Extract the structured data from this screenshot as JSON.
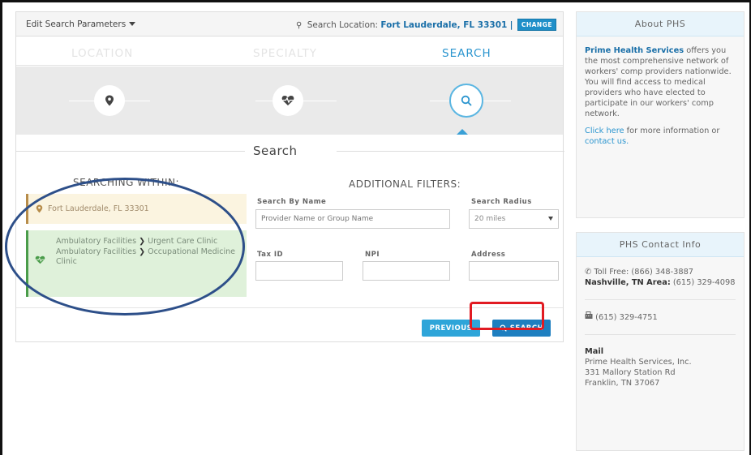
{
  "topbar": {
    "edit_label": "Edit Search Parameters",
    "location_prefix": "Search Location:",
    "location_value": "Fort Lauderdale, FL 33301",
    "separator": "|",
    "change_label": "CHANGE"
  },
  "steps": [
    {
      "label": "LOCATION"
    },
    {
      "label": "SPECIALTY"
    },
    {
      "label": "SEARCH"
    }
  ],
  "search_heading": "Search",
  "within": {
    "title": "SEARCHING WITHIN:",
    "location": "Fort Lauderdale, FL 33301",
    "spec1_a": "Ambulatory Facilities",
    "spec1_b": "Urgent Care Clinic",
    "spec2_a": "Ambulatory Facilities",
    "spec2_b": "Occupational Medicine Clinic",
    "arrow": "❯"
  },
  "filters": {
    "title": "ADDITIONAL FILTERS:",
    "name_label": "Search By Name",
    "name_placeholder": "Provider Name or Group Name",
    "radius_label": "Search Radius",
    "radius_value": "20 miles",
    "taxid_label": "Tax ID",
    "npi_label": "NPI",
    "address_label": "Address"
  },
  "buttons": {
    "previous": "PREVIOUS",
    "search": "SEARCH"
  },
  "about": {
    "title": "About PHS",
    "brand": "Prime Health Services",
    "body": "offers you the most comprehensive network of workers' comp providers nationwide. You will find access to medical providers who have elected to participate in our workers' comp network.",
    "click_here": "Click here",
    "more_info": "for more information or",
    "contact_us": "contact us."
  },
  "contact": {
    "title": "PHS Contact Info",
    "toll_free": "Toll Free: (866) 348-3887",
    "nashville_label": "Nashville, TN Area:",
    "nashville_phone": "(615) 329-4098",
    "fax": "(615) 329-4751",
    "mail_label": "Mail",
    "mail_line1": "Prime Health Services, Inc.",
    "mail_line2": "331 Mallory Station Rd",
    "mail_line3": "Franklin, TN 37067"
  },
  "colors": {
    "accent": "#2b95cf",
    "button_dark": "#1e7fc0",
    "highlight_red": "#e11b22",
    "annotation_blue": "#2d4f89"
  }
}
